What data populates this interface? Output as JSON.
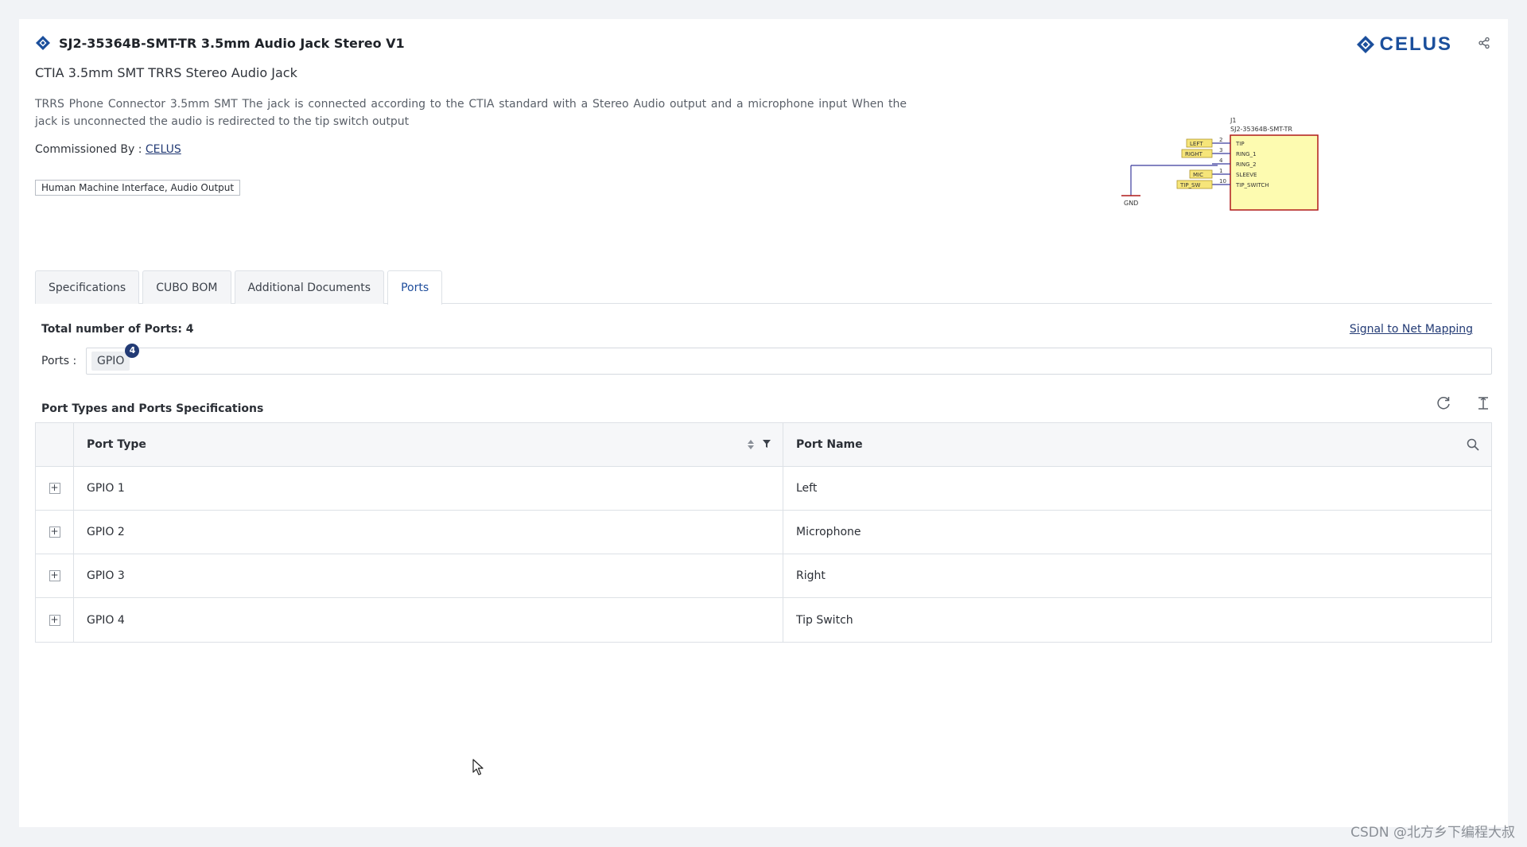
{
  "header": {
    "title": "SJ2-35364B-SMT-TR 3.5mm Audio Jack Stereo V1",
    "subtitle": "CTIA 3.5mm SMT TRRS Stereo Audio Jack",
    "description": "TRRS Phone Connector 3.5mm SMT The jack is connected according to the CTIA standard with a Stereo Audio output and a microphone input When the jack is unconnected the audio is redirected to the tip switch output",
    "commissioned_label": "Commissioned By :",
    "commissioned_by": "CELUS",
    "tag": "Human Machine Interface, Audio Output",
    "logo_text": "CELUS",
    "brand_color": "#1b4f9c"
  },
  "schematic": {
    "ref": "J1",
    "part": "SJ2-35364B-SMT-TR",
    "pins": [
      {
        "net": "LEFT",
        "num": "2",
        "name": "TIP"
      },
      {
        "net": "RIGHT",
        "num": "3",
        "name": "RING_1"
      },
      {
        "net": "",
        "num": "4",
        "name": "RING_2"
      },
      {
        "net": "MIC",
        "num": "1",
        "name": "SLEEVE"
      },
      {
        "net": "TIP_SW",
        "num": "10",
        "name": "TIP_SWITCH"
      }
    ],
    "ground_label": "GND"
  },
  "tabs": [
    {
      "label": "Specifications",
      "active": false
    },
    {
      "label": "CUBO BOM",
      "active": false
    },
    {
      "label": "Additional Documents",
      "active": false
    },
    {
      "label": "Ports",
      "active": true
    }
  ],
  "ports": {
    "total_label": "Total number of Ports: 4",
    "signal_link": "Signal to Net Mapping",
    "ports_label": "Ports :",
    "chip_label": "GPIO",
    "chip_count": "4",
    "section_title": "Port Types and Ports Specifications"
  },
  "table": {
    "columns": [
      "Port Type",
      "Port Name"
    ],
    "rows": [
      {
        "type": "GPIO 1",
        "name": "Left"
      },
      {
        "type": "GPIO 2",
        "name": "Microphone"
      },
      {
        "type": "GPIO 3",
        "name": "Right"
      },
      {
        "type": "GPIO 4",
        "name": "Tip Switch"
      }
    ],
    "expand_symbol": "+"
  },
  "watermark": "CSDN @北方乡下编程大叔"
}
